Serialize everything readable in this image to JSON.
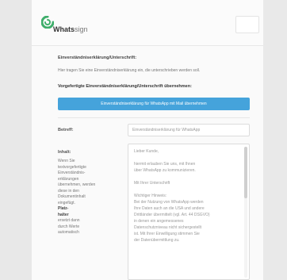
{
  "app": {
    "logo_text_bold": "Whats",
    "logo_text_light": "sign"
  },
  "section": {
    "title": "Einverständniserklärung/Unterschrift:",
    "subtitle": "Hier tragen Sie eine Einverständniserklärung ein, die unterschrieben werden soll.",
    "prefill_label": "Vorgefertigte Einverständniserklärung/Unterschrift übernehmen:",
    "prefill_button": "Einverständniserklärung für WhatsApp mit Mail übernehmen"
  },
  "form": {
    "subject_label": "Betreff:",
    "subject_value": "Einverständniserklärung für WhatsApp",
    "text_label": "Inhalt:",
    "help_lines": [
      "Wenn Sie",
      "textvorgefertigte",
      "Einverständnis-",
      "erklärungen",
      "übernehmen, werden",
      "diese in den",
      "Dokumentinhalt",
      "eingefügt."
    ],
    "help_bold_1": "Platz-",
    "help_bold_2": "halter",
    "help_rest_lines": [
      "ersetzt dann",
      "durch Werte",
      "automatisch"
    ],
    "textarea_lines": [
      "Lieber Kunde,",
      "",
      "hiermit erlauben Sie uns, mit Ihnen",
      "über WhatsApp zu kommunizieren.",
      "",
      "Mit Ihrer Unterschrift",
      "",
      "Wichtiger Hinweis:",
      "Bei der Nutzung von WhatsApp werden",
      "Ihre Daten auch an die USA und andere",
      "Drittländer übermittelt (vgl. Art. 44 DSGVO)",
      "in denen ein angemessenes",
      "Datenschutzniveau nicht sichergestellt",
      "ist. Mit Ihrer Einwilligung stimmen Sie",
      "der Datenübermittlung zu."
    ]
  }
}
